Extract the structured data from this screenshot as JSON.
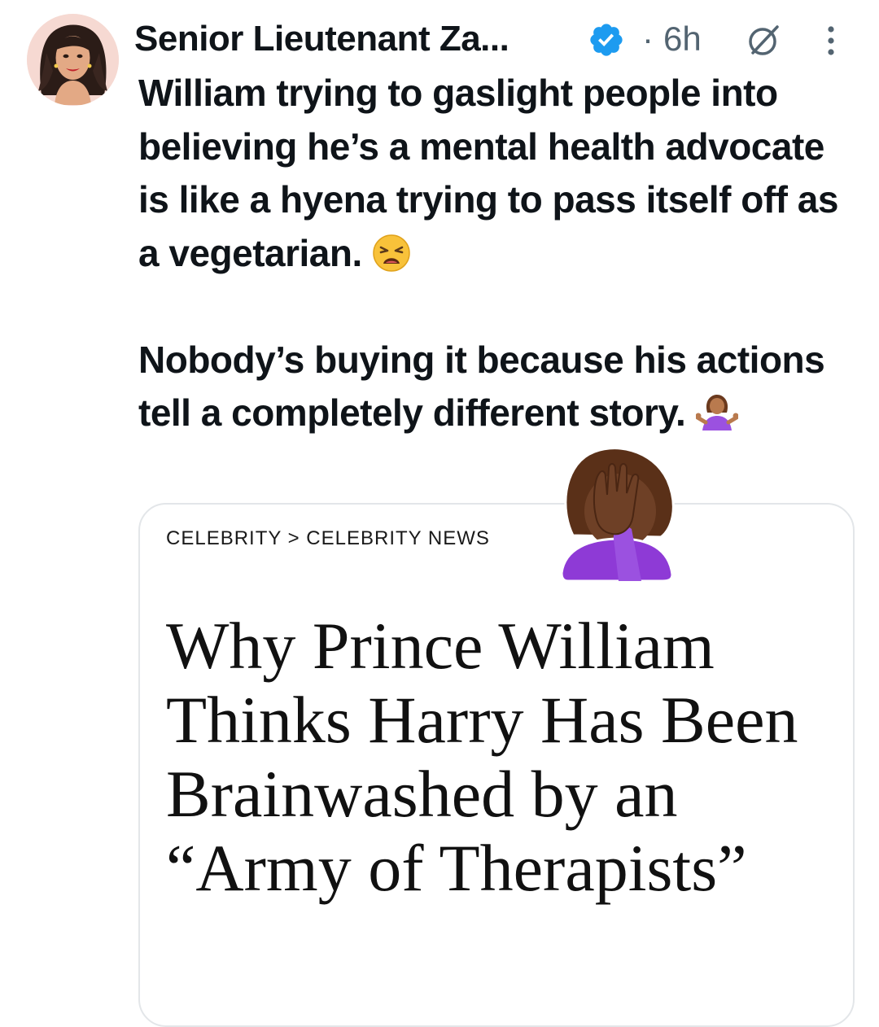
{
  "tweet": {
    "author_name": "Senior Lieutenant Za...",
    "separator": "·",
    "timestamp": "6h",
    "paragraph1": "William trying to gaslight people into believing he’s a mental health advocate is like a hyena trying to pass itself off as a vegetarian.",
    "paragraph1_emoji": "weary-face-emoji",
    "paragraph2": "Nobody’s buying it because his actions tell a completely different story.",
    "paragraph2_emoji": "person-shrugging-emoji",
    "overlay_sticker": "person-facepalming-emoji"
  },
  "icons": {
    "verified": "verified-badge-icon",
    "grok": "grok-icon",
    "more": "more-options-icon",
    "verified_color": "#1d9bf0"
  },
  "card": {
    "breadcrumb": "CELEBRITY > CELEBRITY NEWS",
    "headline": "Why Prince William Thinks Harry Has Been Brainwashed by an “Army of Therapists”"
  }
}
